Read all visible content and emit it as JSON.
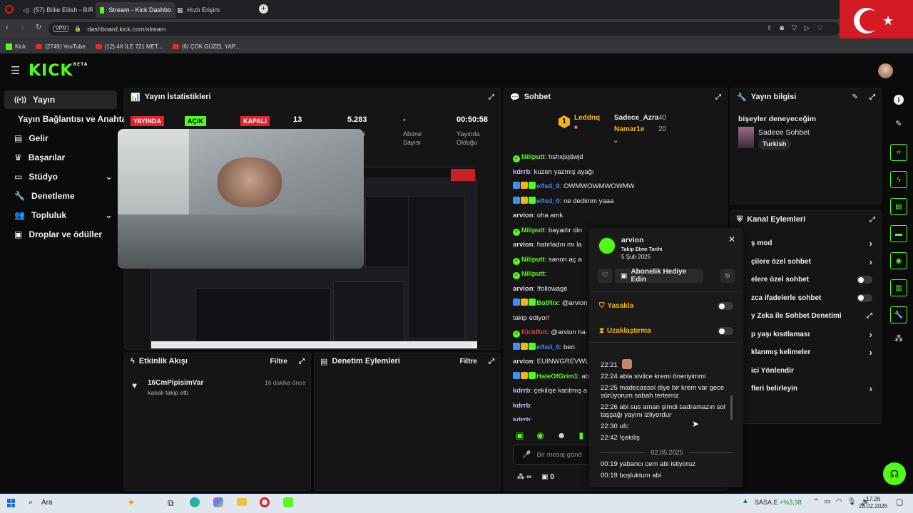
{
  "browser": {
    "tabs": [
      "(57) Billie Eilish - BIRD",
      "Stream - Kick Dashbo",
      "Hızlı Erişim"
    ],
    "url": "dashboard.kick.com/stream",
    "vpn": "VPN",
    "bookmarks": [
      "Kick",
      "(2749) YouTube",
      "(12) 4X İLE 721 MET...",
      "(6) ÇOK GÜZEL YAP..."
    ]
  },
  "app": {
    "logo": "KICK",
    "logo_sup": "BETA",
    "sidebar": [
      {
        "label": "Yayın",
        "icon": "broadcast-icon",
        "active": true
      },
      {
        "label": "Yayın Bağlantısı ve Anahtarı",
        "icon": "",
        "active": false
      },
      {
        "label": "Gelir",
        "icon": "revenue-icon",
        "active": false
      },
      {
        "label": "Başarılar",
        "icon": "trophy-icon",
        "active": false
      },
      {
        "label": "Stüdyo",
        "icon": "studio-icon",
        "active": false,
        "chevron": true
      },
      {
        "label": "Denetleme",
        "icon": "wrench-icon",
        "active": false
      },
      {
        "label": "Topluluk",
        "icon": "community-icon",
        "active": false,
        "chevron": true
      },
      {
        "label": "Droplar ve ödüller",
        "icon": "gift-icon",
        "active": false
      }
    ]
  },
  "stats": {
    "title": "Yayın İstatistikleri",
    "badges": [
      "YAYINDA",
      "AÇIK",
      "KAPALI"
    ],
    "values": [
      {
        "val": "13",
        "sub": ""
      },
      {
        "val": "5.283",
        "sub": "ci"
      },
      {
        "val": "-",
        "sub": "Abone Sayısı"
      },
      {
        "val": "00:50:58",
        "sub": "Yayında Olduğu"
      }
    ]
  },
  "chat": {
    "title": "Sohbet",
    "leaders": {
      "rank": "1",
      "first": "Leddnq",
      "second": "Sadece_Azra",
      "second_count": "40",
      "third": "Namar1e",
      "third_count": "20"
    },
    "lines": [
      {
        "user": "Niliputt",
        "text": ": hshxjsjdwjd",
        "color": "#53fc18",
        "v": true
      },
      {
        "user": "kdrrb",
        "text": ": kuzen yazmış ayağı",
        "color": "#c9b6ff"
      },
      {
        "user": "elfsd_0",
        "text": ": OWMWOWMWOWMWD",
        "color": "#3b8fff",
        "b": true
      },
      {
        "user": "elfsd_0",
        "text": ": ne dedimm yaaa",
        "color": "#3b8fff",
        "b": true
      },
      {
        "user": "arvion",
        "text": ": oha amk",
        "color": "#ddd"
      },
      {
        "user": "Niliputt",
        "text": ": bayadır din",
        "color": "#53fc18",
        "v": true
      },
      {
        "user": "arvion",
        "text": ": hatırladın mı la",
        "color": "#ddd"
      },
      {
        "user": "Niliputt",
        "text": ": sanon aç a",
        "color": "#53fc18",
        "v": true
      },
      {
        "user": "Niliputt",
        "text": ":",
        "color": "#53fc18",
        "v": true
      },
      {
        "user": "arvion",
        "text": ": !followage",
        "color": "#ddd"
      },
      {
        "user": "BotRix",
        "text": ": @arvion",
        "color": "#53fc18",
        "b": true
      },
      {
        "user": "",
        "text": "takip ediyor!",
        "color": "#ddd"
      },
      {
        "user": "KickBot",
        "text": ": @arvion ha",
        "color": "#e23c3c",
        "v": true
      },
      {
        "user": "elfsd_0",
        "text": ": ben",
        "color": "#3b8fff",
        "b": true
      },
      {
        "user": "arvion",
        "text": ": EUINWGREVWL",
        "color": "#ddd"
      },
      {
        "user": "HaleOfGrim1",
        "text": ": abi ya",
        "color": "#53fc18",
        "b": true
      },
      {
        "user": "kdrrb",
        "text": ": çekilişe katılmış a",
        "color": "#c9b6ff"
      },
      {
        "user": "kdrrb",
        "text": ":",
        "color": "#c9b6ff"
      },
      {
        "user": "kdrrb",
        "text": ":",
        "color": "#c9b6ff"
      }
    ],
    "input_placeholder": "Bir mesaj gönd",
    "infinite": "∞",
    "count": "0"
  },
  "stream_info": {
    "title": "Yayın bilgisi",
    "stream_title": "bişeyler deneyeceğim",
    "category": "Sadece Sohbet",
    "language": "Turkish"
  },
  "channel_actions": {
    "title": "Kanal Eylemleri",
    "rows": [
      {
        "label": "ş mod",
        "type": "chevron"
      },
      {
        "label": "çilere özel sohbet",
        "type": "chevron"
      },
      {
        "label": "elere özel sohbet",
        "type": "toggle"
      },
      {
        "label": "zca ifadelerle sohbet",
        "type": "toggle"
      },
      {
        "label": "y Zeka ile Sohbet Denetimi",
        "type": "external"
      },
      {
        "label": "p yaşı kısıtlaması",
        "type": "chevron"
      },
      {
        "label": "klanmış kelimeler",
        "type": "chevron"
      },
      {
        "label": "ici Yönlendir",
        "type": "none"
      },
      {
        "label": "fleri belirleyin",
        "type": "chevron"
      }
    ]
  },
  "popup": {
    "username": "arvion",
    "follow_label": "Takip Etme Tarihi",
    "follow_date": "5 Şub 2025",
    "gift_button": "Abonelik Hediye Edin",
    "ban": "Yasakla",
    "timeout": "Uzaklaştırma",
    "messages": [
      {
        "time": "22:21",
        "text": ""
      },
      {
        "time": "22:24",
        "text": "abla sivilce kremi öneriyimmi"
      },
      {
        "time": "22:25",
        "text": "madecassol diye bir krem var gece sürüyorum sabah tertemiz"
      },
      {
        "time": "22:26",
        "text": "abi sus aman şimdi sadramazın sol taşşağı yayını izliyordur"
      },
      {
        "time": "22:30",
        "text": "ufc"
      },
      {
        "time": "22:42",
        "text": "!çekiliş"
      }
    ],
    "date_divider": "02.05.2025",
    "after_msg": {
      "time": "00:19",
      "text": "yabancı cem abi istiyoruz"
    },
    "cut_msg": "00:19 boşluktum abi"
  },
  "activity": {
    "title": "Etkinlik Akışı",
    "filter": "Filtre",
    "item_user": "16CmPipisimVar",
    "item_text": "kanalı takip etti",
    "item_time": "16 dakika önce"
  },
  "moderation": {
    "title": "Denetim Eylemleri",
    "filter": "Filtre"
  },
  "taskbar": {
    "search": "Ara",
    "stock": "SASA.E",
    "stock_change": "+%3,38",
    "time": "17:26",
    "date": "26.02.2026"
  },
  "colors": {
    "accent": "#53fc18",
    "live": "#e1232f"
  }
}
